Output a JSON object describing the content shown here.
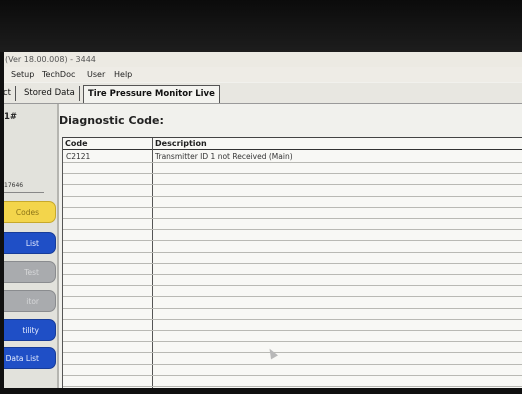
{
  "window": {
    "title": "(Ver 18.00.008) - 3444"
  },
  "menu": [
    "Setup",
    "TechDoc",
    "User",
    "Help"
  ],
  "tabs": [
    {
      "label": "ct",
      "active": false
    },
    {
      "label": "Stored Data",
      "active": false
    },
    {
      "label": "Tire Pressure Monitor Live",
      "active": true
    }
  ],
  "sidebar": {
    "title": "1#",
    "id_text": "17646",
    "buttons": [
      {
        "label": "Codes",
        "color": "yellow"
      },
      {
        "label": "List",
        "color": "blue"
      },
      {
        "label": "Test",
        "color": "gray"
      },
      {
        "label": "itor",
        "color": "gray"
      },
      {
        "label": "tility",
        "color": "blue"
      },
      {
        "label": "Data List",
        "color": "blue"
      }
    ]
  },
  "main": {
    "heading": "Diagnostic Code:",
    "table": {
      "headers": [
        "Code",
        "Description"
      ],
      "rows": [
        {
          "code": "C2121",
          "description": "Transmitter ID 1 not Received (Main)"
        }
      ]
    }
  },
  "colors": {
    "yellow_button": "#f3d54b",
    "blue_button": "#1f4fc6",
    "gray_button": "#a9abae"
  }
}
